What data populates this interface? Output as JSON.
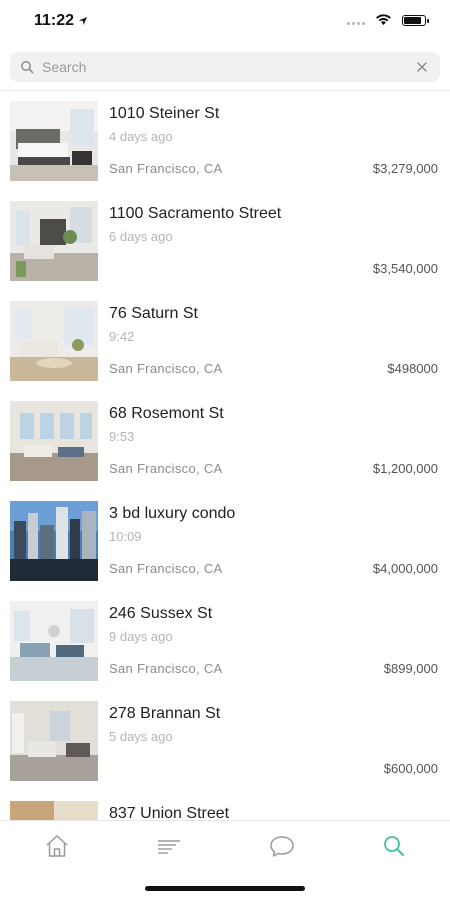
{
  "status": {
    "time": "11:22",
    "battery_level": 0.9
  },
  "search": {
    "placeholder": "Search",
    "value": ""
  },
  "listings": [
    {
      "title": "1010 Steiner St",
      "date": "4 days ago",
      "location": "San Francisco, CA",
      "price": "$3,279,000"
    },
    {
      "title": "1100 Sacramento Street",
      "date": "6 days ago",
      "location": "",
      "price": "$3,540,000"
    },
    {
      "title": "76 Saturn St",
      "date": "9:42",
      "location": "San Francisco, CA",
      "price": "$498000"
    },
    {
      "title": "68 Rosemont St",
      "date": "9:53",
      "location": "San Francisco, CA",
      "price": "$1,200,000"
    },
    {
      "title": "3 bd luxury condo",
      "date": "10:09",
      "location": "San Francisco, CA",
      "price": "$4,000,000"
    },
    {
      "title": "246 Sussex St",
      "date": "9 days ago",
      "location": "San Francisco, CA",
      "price": "$899,000"
    },
    {
      "title": "278 Brannan St",
      "date": "5 days ago",
      "location": "",
      "price": "$600,000"
    },
    {
      "title": "837 Union Street",
      "date": "",
      "location": "",
      "price": ""
    }
  ],
  "tabs": [
    {
      "icon": "home-icon",
      "active": false
    },
    {
      "icon": "list-icon",
      "active": false
    },
    {
      "icon": "chat-icon",
      "active": false
    },
    {
      "icon": "search-icon",
      "active": true
    }
  ],
  "colors": {
    "active_tab": "#3cc59a",
    "inactive_tab": "#9a9a9a",
    "search_bg": "#f1f1f3"
  }
}
